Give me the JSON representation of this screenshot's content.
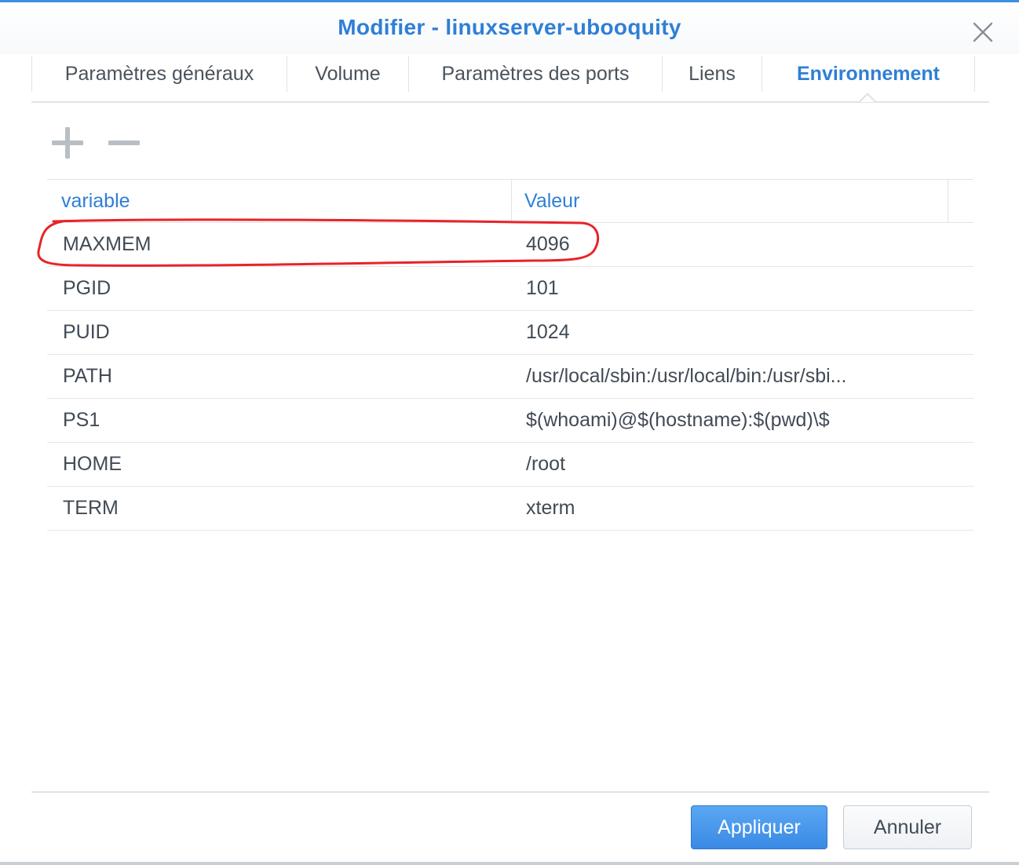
{
  "dialog": {
    "title": "Modifier - linuxserver-ubooquity"
  },
  "tabs": [
    {
      "label": "Paramètres généraux",
      "active": false
    },
    {
      "label": "Volume",
      "active": false
    },
    {
      "label": "Paramètres des ports",
      "active": false
    },
    {
      "label": "Liens",
      "active": false
    },
    {
      "label": "Environnement",
      "active": true
    }
  ],
  "toolbar": {
    "add_icon": "plus-icon",
    "remove_icon": "minus-icon"
  },
  "grid": {
    "columns": [
      "variable",
      "Valeur"
    ],
    "rows": [
      {
        "variable": "MAXMEM",
        "value": "4096"
      },
      {
        "variable": "PGID",
        "value": "101"
      },
      {
        "variable": "PUID",
        "value": "1024"
      },
      {
        "variable": "PATH",
        "value": "/usr/local/sbin:/usr/local/bin:/usr/sbi..."
      },
      {
        "variable": "PS1",
        "value": "$(whoami)@$(hostname):$(pwd)\\$"
      },
      {
        "variable": "HOME",
        "value": "/root"
      },
      {
        "variable": "TERM",
        "value": "xterm"
      }
    ]
  },
  "footer": {
    "apply_label": "Appliquer",
    "cancel_label": "Annuler"
  },
  "colors": {
    "accent": "#2f7fd6",
    "annotation": "#e8232a",
    "apply_button": "#3a8ae5"
  }
}
